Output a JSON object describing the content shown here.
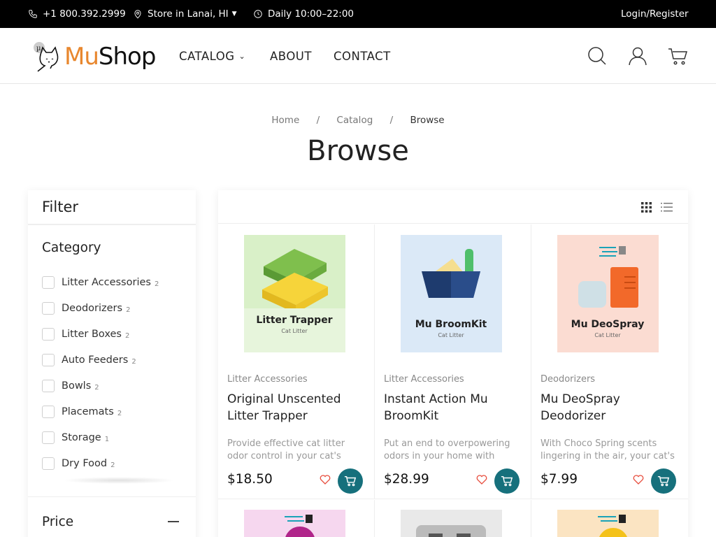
{
  "topbar": {
    "phone": "+1 800.392.2999",
    "store": "Store in Lanai, HI",
    "hours": "Daily 10:00–22:00",
    "login": "Login/Register"
  },
  "header": {
    "logo_mu": "Mu",
    "logo_shop": "Shop",
    "logo_badge": "µ",
    "nav": [
      {
        "label": "CATALOG"
      },
      {
        "label": "ABOUT"
      },
      {
        "label": "CONTACT"
      }
    ]
  },
  "breadcrumb": {
    "items": [
      "Home",
      "Catalog",
      "Browse"
    ],
    "separator": "/"
  },
  "page_title": "Browse",
  "filter": {
    "title": "Filter",
    "category_title": "Category",
    "categories": [
      {
        "label": "Litter Accessories",
        "count": "2"
      },
      {
        "label": "Deodorizers",
        "count": "2"
      },
      {
        "label": "Litter Boxes",
        "count": "2"
      },
      {
        "label": "Auto Feeders",
        "count": "2"
      },
      {
        "label": "Bowls",
        "count": "2"
      },
      {
        "label": "Placemats",
        "count": "2"
      },
      {
        "label": "Storage",
        "count": "1"
      },
      {
        "label": "Dry Food",
        "count": "2"
      }
    ],
    "price_title": "Price"
  },
  "products": [
    {
      "category": "Litter Accessories",
      "name": "Original Unscented Litter Trapper",
      "desc": "Provide effective cat litter odor control in your cat's",
      "price": "$18.50",
      "img_title": "Litter Trapper",
      "img_sub": "Cat Litter",
      "img_bg": "#d9f0c8"
    },
    {
      "category": "Litter Accessories",
      "name": "Instant Action Mu BroomKit",
      "desc": "Put an end to overpowering odors in your home with",
      "price": "$28.99",
      "img_title": "Mu BroomKit",
      "img_sub": "Cat Litter",
      "img_bg": "#dbe9f7"
    },
    {
      "category": "Deodorizers",
      "name": "Mu DeoSpray Deodorizer",
      "desc": "With Choco Spring scents lingering in the air, your cat's",
      "price": "$7.99",
      "img_title": "Mu DeoSpray",
      "img_sub": "Cat Litter",
      "img_bg": "#fbdcd2"
    }
  ],
  "row2_bgs": [
    "#f6d7ef",
    "#e9e9e9",
    "#fbe4c2"
  ],
  "colors": {
    "accent": "#16707c",
    "logo_orange": "#e8872e",
    "heart": "#e74c3c"
  },
  "icons": {
    "phone": "phone-icon",
    "location": "map-pin-icon",
    "clock": "clock-icon",
    "search": "search-icon",
    "user": "user-icon",
    "cart": "cart-icon",
    "grid": "grid-view-icon",
    "list": "list-view-icon",
    "heart": "heart-icon"
  }
}
